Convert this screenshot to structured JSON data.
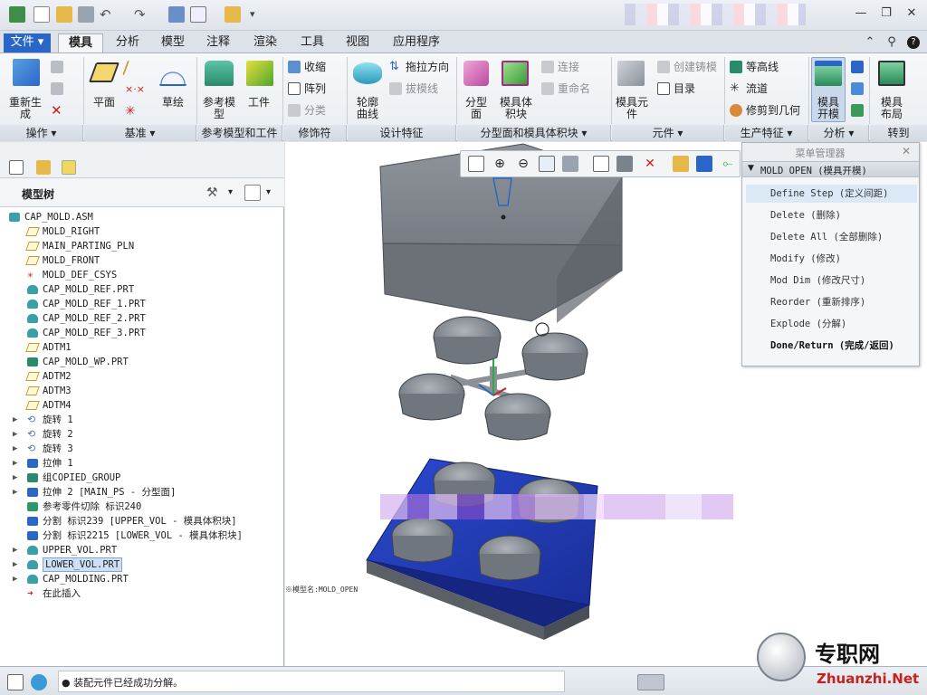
{
  "tabs": [
    "文件",
    "模具",
    "分析",
    "模型",
    "注释",
    "渲染",
    "工具",
    "视图",
    "应用程序"
  ],
  "ribbon": {
    "btn_regenerate": "重新生\n成",
    "btn_plane": "平面",
    "btn_sketch": "草绘",
    "btn_ref_model": "参考模\n型",
    "btn_workpiece": "工件",
    "btn_shrink": "收缩",
    "btn_pattern": "阵列",
    "btn_classify": "分类",
    "btn_silhouette": "轮廓\n曲线",
    "btn_draw_dir": "拖拉方向",
    "btn_draft_check": "拔模线",
    "btn_parting_surf": "分型\n面",
    "btn_mold_vol": "模具体\n积块",
    "btn_connect": "连接",
    "btn_rename": "重命名",
    "btn_mold_comp": "模具元\n件",
    "btn_create_casting": "创建铸模",
    "btn_catalog": "目录",
    "btn_contour": "等高线",
    "btn_runner": "流道",
    "btn_trim": "修剪到几何",
    "btn_mold_open": "模具\n开模",
    "btn_mold_layout": "模具\n布局",
    "groups": {
      "operations": "操作",
      "datum": "基准",
      "ref_model_workpiece": "参考模型和工件",
      "modifiers": "修饰符",
      "design_features": "设计特征",
      "parting_vol": "分型面和模具体积块",
      "components": "元件",
      "production": "生产特征",
      "analysis": "分析",
      "goto": "转到"
    }
  },
  "model_tree": {
    "title": "模型树",
    "rows": [
      {
        "text": "CAP_MOLD.ASM",
        "icon": "assembly-icon",
        "expander": false
      },
      {
        "text": "MOLD_RIGHT",
        "icon": "datum-plane-icon",
        "expander": false
      },
      {
        "text": "MAIN_PARTING_PLN",
        "icon": "datum-plane-icon",
        "expander": false
      },
      {
        "text": "MOLD_FRONT",
        "icon": "datum-plane-icon",
        "expander": false
      },
      {
        "text": "MOLD_DEF_CSYS",
        "icon": "csys-icon",
        "expander": false
      },
      {
        "text": "CAP_MOLD_REF.PRT",
        "icon": "part-icon",
        "expander": false
      },
      {
        "text": "CAP_MOLD_REF_1.PRT",
        "icon": "part-icon",
        "expander": false
      },
      {
        "text": "CAP_MOLD_REF_2.PRT",
        "icon": "part-icon",
        "expander": false
      },
      {
        "text": "CAP_MOLD_REF_3.PRT",
        "icon": "part-icon",
        "expander": false
      },
      {
        "text": "ADTM1",
        "icon": "datum-plane-icon",
        "expander": false
      },
      {
        "text": "CAP_MOLD_WP.PRT",
        "icon": "workpiece-icon",
        "expander": false
      },
      {
        "text": "ADTM2",
        "icon": "datum-plane-icon",
        "expander": false
      },
      {
        "text": "ADTM3",
        "icon": "datum-plane-icon",
        "expander": false
      },
      {
        "text": "ADTM4",
        "icon": "datum-plane-icon",
        "expander": false
      },
      {
        "text": "旋转 1",
        "icon": "revolve-icon",
        "expander": true
      },
      {
        "text": "旋转 2",
        "icon": "revolve-icon",
        "expander": true
      },
      {
        "text": "旋转 3",
        "icon": "revolve-icon",
        "expander": true
      },
      {
        "text": "拉伸 1",
        "icon": "extrude-icon",
        "expander": true
      },
      {
        "text": "组COPIED_GROUP",
        "icon": "group-icon",
        "expander": true
      },
      {
        "text": "拉伸 2 [MAIN_PS - 分型面]",
        "icon": "extrude-icon",
        "expander": true
      },
      {
        "text": "参考零件切除 标识240",
        "icon": "cutout-icon",
        "expander": false
      },
      {
        "text": "分割 标识239 [UPPER_VOL - 模具体积块]",
        "icon": "split-icon",
        "expander": false
      },
      {
        "text": "分割 标识2215 [LOWER_VOL - 模具体积块]",
        "icon": "split-icon",
        "expander": false
      },
      {
        "text": "UPPER_VOL.PRT",
        "icon": "part-icon",
        "expander": true
      },
      {
        "text": "LOWER_VOL.PRT",
        "icon": "part-icon",
        "expander": true,
        "selected": true
      },
      {
        "text": "CAP_MOLDING.PRT",
        "icon": "part-icon",
        "expander": true
      },
      {
        "text": "在此插入",
        "icon": "insert-arrow-icon",
        "expander": false
      }
    ]
  },
  "menu_manager": {
    "title": "菜单管理器",
    "section": "MOLD OPEN (模具开模)",
    "items": [
      "Define Step (定义间距)",
      "Delete (删除)",
      "Delete All (全部删除)",
      "Modify (修改)",
      "Mod Dim (修改尺寸)",
      "Reorder (重新排序)",
      "Explode (分解)",
      "Done/Return (完成/返回)"
    ]
  },
  "canvas": {
    "model_label": "※模型名:MOLD_OPEN"
  },
  "status": {
    "message": "● 装配元件已经成功分解。"
  },
  "watermark": {
    "cn": "专职网",
    "en": "Zhuanzhi.Net"
  },
  "colors": {
    "upper_plate": "#7d8288",
    "lower_plate": "#1f3fb8",
    "caps": "#7a8087",
    "accent": "#2a66c8"
  }
}
